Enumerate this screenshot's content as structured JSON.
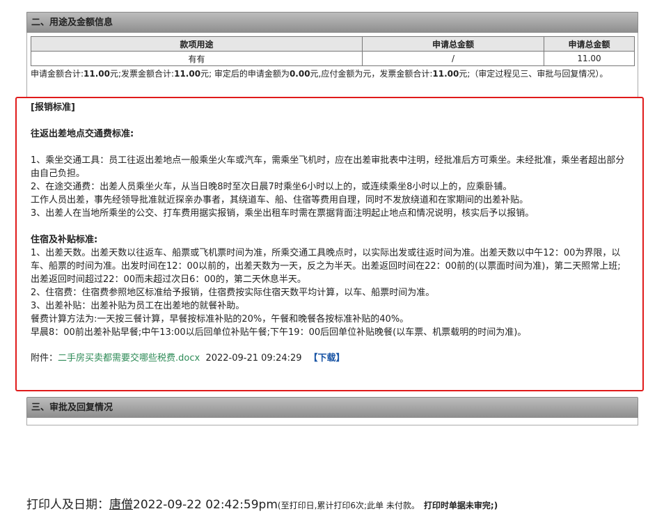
{
  "section2": {
    "title": "二、用途及金额信息",
    "table": {
      "headers": [
        "款项用途",
        "申请总金额",
        "申请总金额"
      ],
      "row": [
        "有有",
        "/",
        "11.00"
      ]
    },
    "summary": {
      "p1": "申请金额合计:",
      "v1": "11.00",
      "p2": "元;发票金额合计:",
      "v2": "11.00",
      "p3": "元; 审定后的申请金额为",
      "v3": "0.00",
      "p4": "元,应付金额为元，发票金额合计:",
      "v4": "11.00",
      "p5": "元;（审定过程见三、审批与回复情况）。"
    }
  },
  "standard": {
    "heading": "[报销标准]",
    "transport_title": "往返出差地点交通费标准:",
    "transport_lines": [
      "1、乘坐交通工具：员工往返出差地点一般乘坐火车或汽车，需乘坐飞机时，应在出差审批表中注明，经批准后方可乘坐。未经批准，乘坐者超出部分由自己负担。",
      "2、在途交通费：出差人员乘坐火车，从当日晚8时至次日晨7时乘坐6小时以上的，或连续乘坐8小时以上的，应乘卧铺。",
      "工作人员出差，事先经领导批准就近探亲办事者，其绕道车、船、住宿等费用自理，同时不发放绕道和在家期间的出差补贴。",
      "3、出差人在当地所乘坐的公交、打车费用据实报销，乘坐出租车时需在票据背面注明起止地点和情况说明，核实后予以报销。"
    ],
    "lodging_title": "住宿及补贴标准:",
    "lodging_lines": [
      "1、出差天数。出差天数以往返车、船票或飞机票时间为准，所乘交通工具晚点时，以实际出发或往返时间为准。出差天数以中午12：00为界限，以车、船票的时间为准。出发时间在12：00以前的，出差天数为一天，反之为半天。出差返回时间在22：00前的(以票面时间为准)，第二天照常上班;出差返回时间超过22：00而未超过次日6：00的，第二天休息半天。",
      "2、住宿费：住宿费参照地区标准给予报销，住宿费按实际住宿天数平均计算，以车、船票时间为准。",
      "3、出差补贴：出差补贴为员工在出差地的就餐补助。",
      "餐费计算方法为:一天按三餐计算，早餐按标准补贴的20%，午餐和晚餐各按标准补贴的40%。",
      "早晨8：00前出差补贴早餐;中午13:00以后回单位补贴午餐;下午19：00后回单位补贴晚餐(以车票、机票载明的时间为准)。"
    ],
    "attachment": {
      "label": "附件：",
      "file_name": "二手房买卖都需要交哪些税费.docx",
      "timestamp": "2022-09-21 09:24:29",
      "download_label": "【下载】"
    }
  },
  "section3": {
    "title": "三、审批及回复情况"
  },
  "print_info": {
    "label": "打印人及日期：",
    "name": "唐僧",
    "datetime": "2022-09-22 02:42:59pm",
    "note": "(至打印日,累计打印6次;此单 未付款。",
    "warning": "打印时单据未审完;)"
  },
  "colors": {
    "highlight_border": "#e01a1a",
    "file_link": "#2e8b57",
    "download_link": "#1a55a5",
    "header_bg": "#a6a6a6"
  }
}
